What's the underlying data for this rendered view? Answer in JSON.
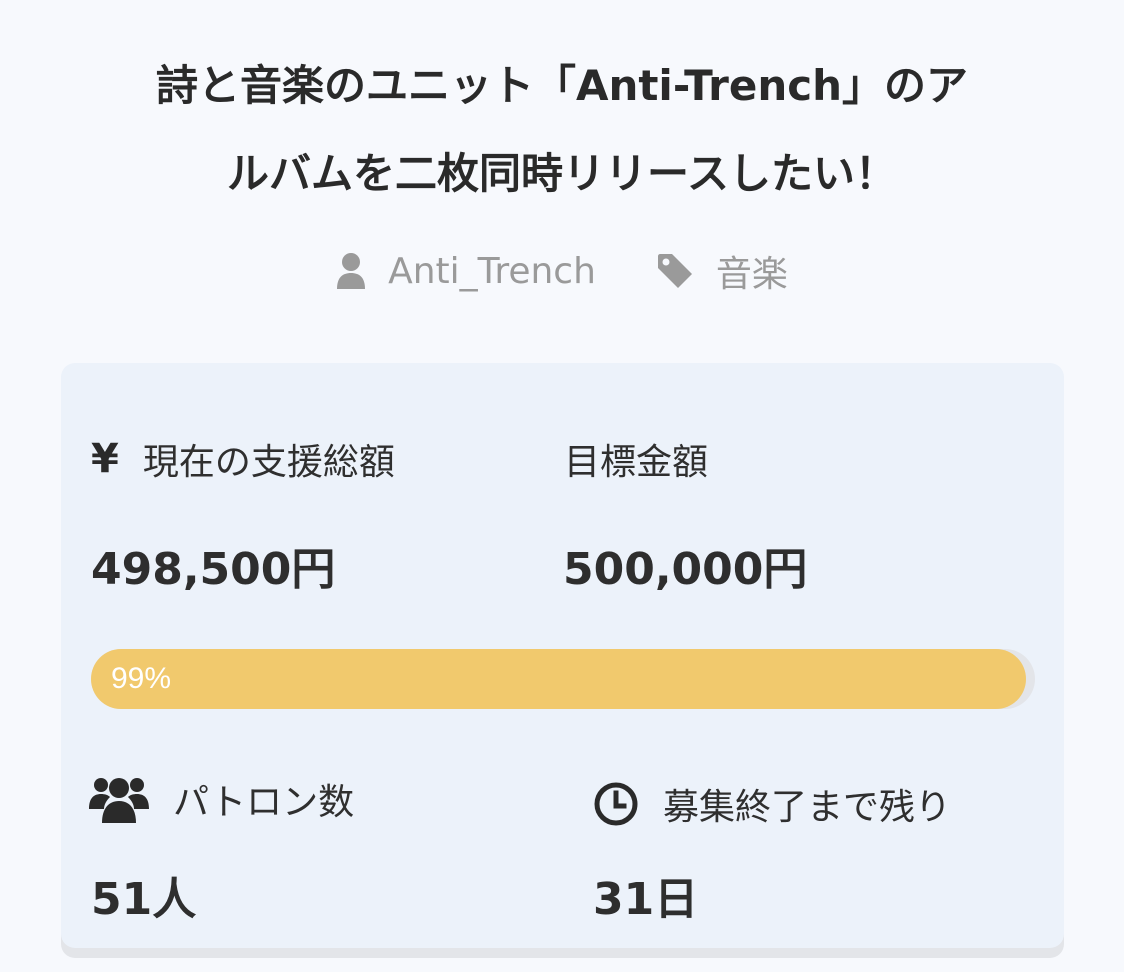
{
  "header": {
    "title_line1": "詩と音楽のユニット「Anti-Trench」のア",
    "title_line2": "ルバムを二枚同時リリースしたい！"
  },
  "meta": {
    "author": "Anti_Trench",
    "category": "音楽",
    "author_icon": "user-icon",
    "category_icon": "tag-icon"
  },
  "stats": {
    "current": {
      "icon": "yen-icon",
      "icon_glyph": "¥",
      "label": "現在の支援総額",
      "value": "498,500円"
    },
    "goal": {
      "label": "目標金額",
      "value": "500,000円"
    },
    "progress": {
      "percent": 99,
      "label": "99%"
    },
    "patrons": {
      "icon": "users-icon",
      "label": "パトロン数",
      "value": "51人"
    },
    "remaining": {
      "icon": "clock-icon",
      "label": "募集終了まで残り",
      "value": "31日"
    }
  },
  "colors": {
    "background": "#f7f9fd",
    "card": "#ecf2fa",
    "progress_fill": "#f1c96d",
    "progress_track": "#e3e5e9",
    "muted_text": "#9a9a9a"
  }
}
